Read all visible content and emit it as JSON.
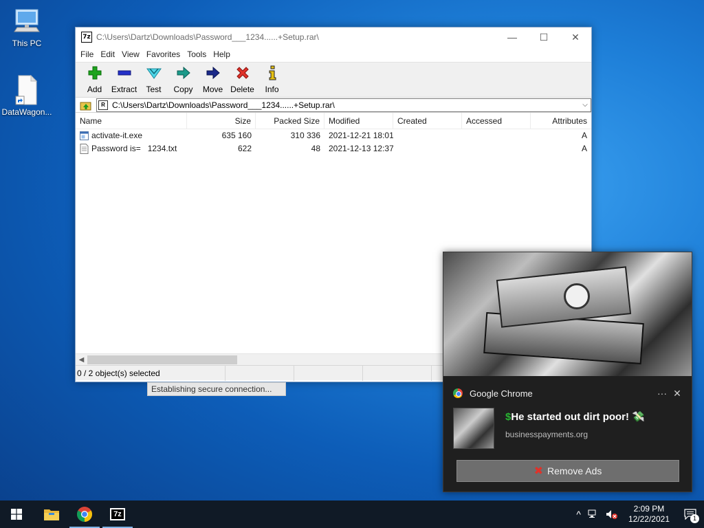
{
  "desktop": {
    "icons": [
      {
        "label": "This PC"
      },
      {
        "label": "DataWagon..."
      }
    ]
  },
  "window": {
    "badge": "7z",
    "title": "C:\\Users\\Dartz\\Downloads\\Password___1234......+Setup.rar\\",
    "controls": {
      "minimize": "—",
      "maximize": "☐",
      "close": "✕"
    },
    "menu": [
      "File",
      "Edit",
      "View",
      "Favorites",
      "Tools",
      "Help"
    ],
    "toolbar": [
      "Add",
      "Extract",
      "Test",
      "Copy",
      "Move",
      "Delete",
      "Info"
    ],
    "address": "C:\\Users\\Dartz\\Downloads\\Password___1234......+Setup.rar\\",
    "address_badge": "R",
    "columns": [
      "Name",
      "Size",
      "Packed Size",
      "Modified",
      "Created",
      "Accessed",
      "Attributes"
    ],
    "files": [
      {
        "name": "activate-it.exe",
        "size": "635 160",
        "packed": "310 336",
        "modified": "2021-12-21 18:01",
        "created": "",
        "accessed": "",
        "attr": "A"
      },
      {
        "name": "Password is=   1234.txt",
        "size": "622",
        "packed": "48",
        "modified": "2021-12-13 12:37",
        "created": "",
        "accessed": "",
        "attr": "A"
      }
    ],
    "status": "0 / 2 object(s) selected",
    "progress_text": "Establishing secure connection..."
  },
  "notification": {
    "app": "Google Chrome",
    "more": "···",
    "close": "✕",
    "title_prefix": "$",
    "title": "He started out dirt poor!",
    "title_suffix": "💸",
    "site": "businesspayments.org",
    "action_icon": "✖",
    "action": "Remove Ads"
  },
  "taskbar": {
    "apps": [
      "windows-start",
      "file-explorer",
      "chrome",
      "7zip"
    ],
    "badge_7z": "7z",
    "tray_chevron": "^",
    "time": "2:09 PM",
    "date": "12/22/2021",
    "notification_count": "1"
  },
  "colors": {
    "desktop_blue": "#1e7fd8",
    "taskbar": "#101a26",
    "notification_bg": "#1f1f1f",
    "add_green": "#1da31d",
    "delete_red": "#e0322a"
  }
}
